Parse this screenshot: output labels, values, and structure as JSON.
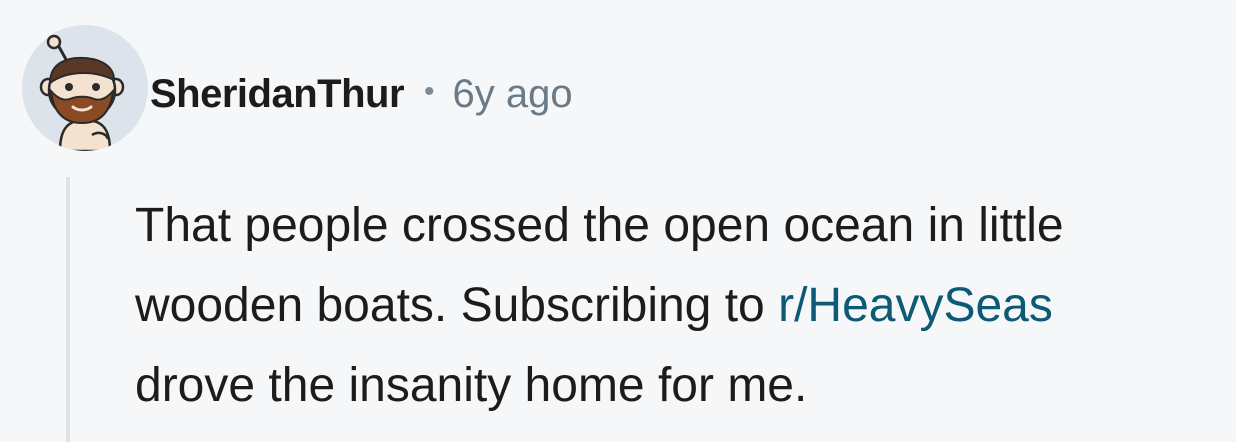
{
  "comment": {
    "author": "SheridanThur",
    "separator": "•",
    "timestamp": "6y ago",
    "avatar_icon": "snoo-avatar-icon",
    "body": {
      "line1": "That people crossed the open ocean in little",
      "line2_before_link": "wooden boats. Subscribing to ",
      "link_text": "r/HeavySeas",
      "line3": "drove the insanity home for me."
    }
  },
  "colors": {
    "background": "#f6f7f8",
    "text": "#1c1c1c",
    "muted": "#6a7a88",
    "link": "#0c5a76",
    "thread_line": "#dfe3e7"
  }
}
